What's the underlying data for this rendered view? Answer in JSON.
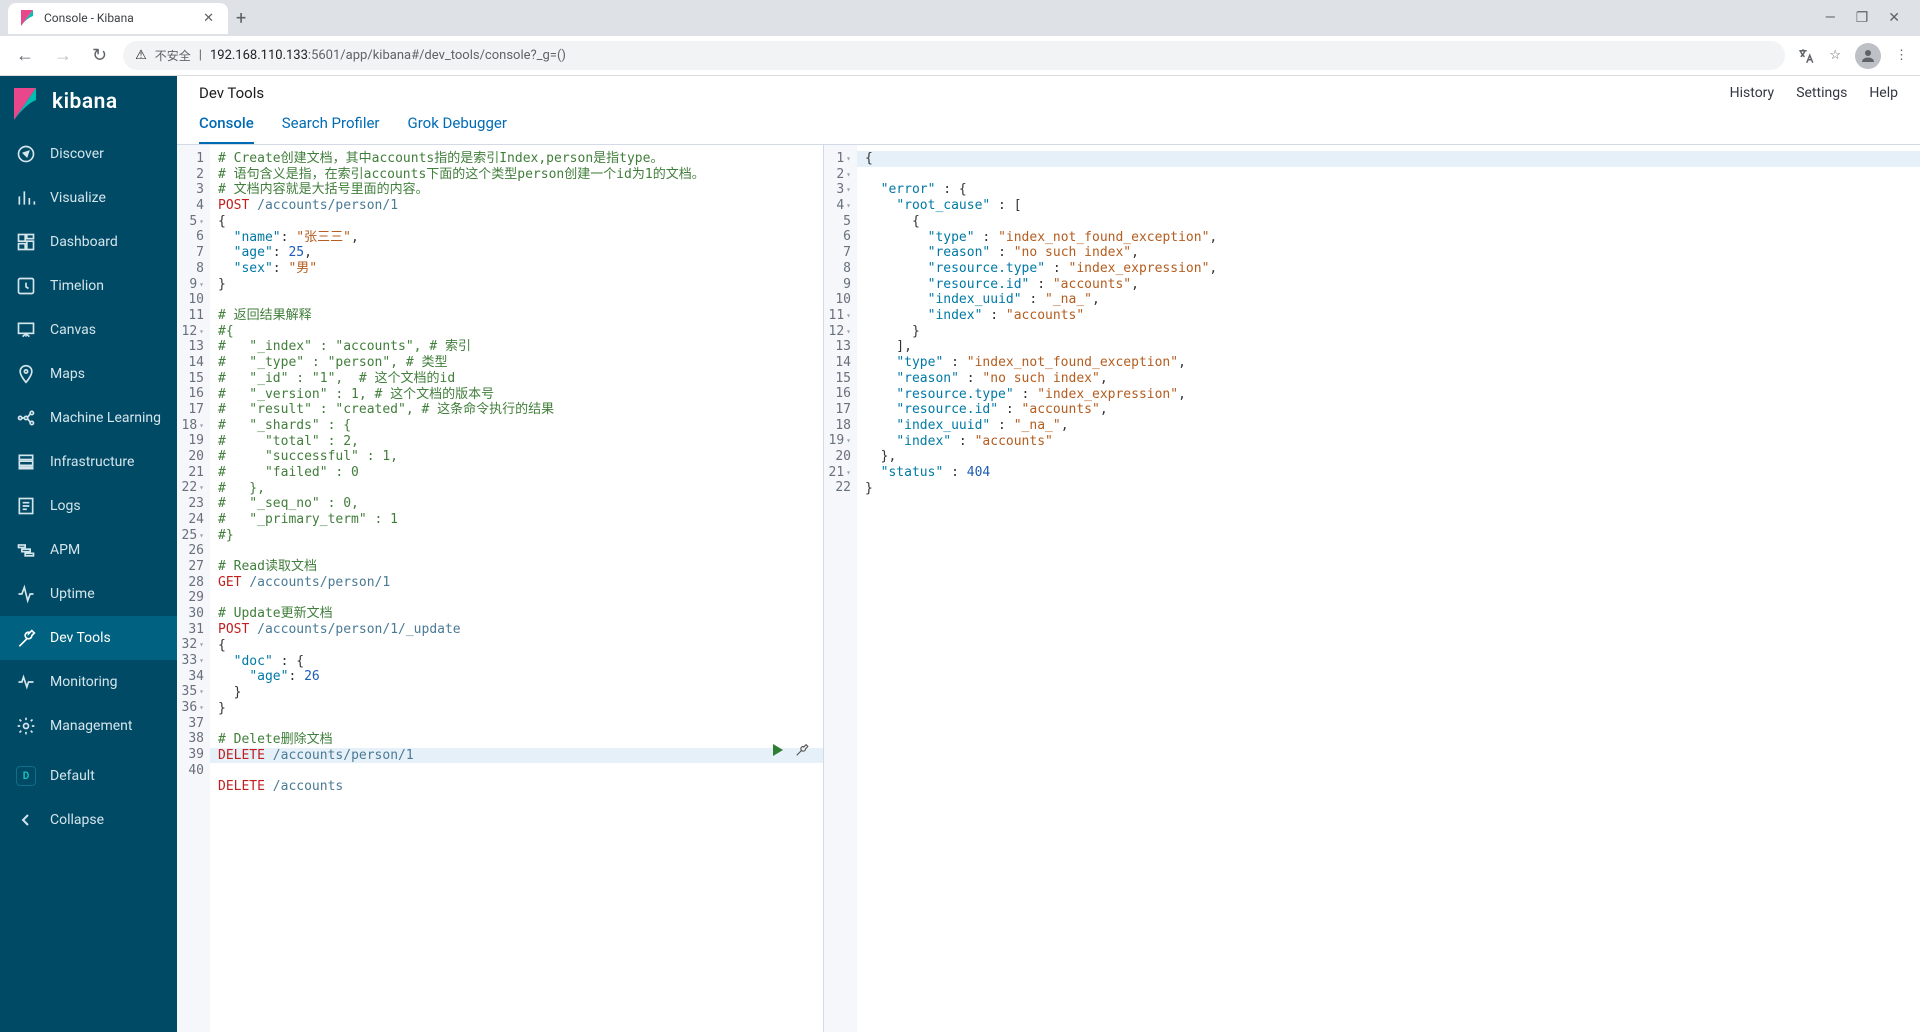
{
  "browser": {
    "tab_title": "Console - Kibana",
    "insecure_label": "不安全",
    "url_host": "192.168.110.133",
    "url_rest": ":5601/app/kibana#/dev_tools/console?_g=()"
  },
  "logo": "kibana",
  "sidebar": [
    {
      "id": "discover",
      "label": "Discover"
    },
    {
      "id": "visualize",
      "label": "Visualize"
    },
    {
      "id": "dashboard",
      "label": "Dashboard"
    },
    {
      "id": "timelion",
      "label": "Timelion"
    },
    {
      "id": "canvas",
      "label": "Canvas"
    },
    {
      "id": "maps",
      "label": "Maps"
    },
    {
      "id": "ml",
      "label": "Machine Learning"
    },
    {
      "id": "infrastructure",
      "label": "Infrastructure"
    },
    {
      "id": "logs",
      "label": "Logs"
    },
    {
      "id": "apm",
      "label": "APM"
    },
    {
      "id": "uptime",
      "label": "Uptime"
    },
    {
      "id": "devtools",
      "label": "Dev Tools",
      "active": true
    },
    {
      "id": "monitoring",
      "label": "Monitoring"
    },
    {
      "id": "management",
      "label": "Management"
    }
  ],
  "space_letter": "D",
  "space_label": "Default",
  "collapse_label": "Collapse",
  "crumb": "Dev Tools",
  "actions": {
    "history": "History",
    "settings": "Settings",
    "help": "Help"
  },
  "tabs": [
    {
      "id": "console",
      "label": "Console",
      "active": true
    },
    {
      "id": "searchprofiler",
      "label": "Search Profiler"
    },
    {
      "id": "grok",
      "label": "Grok Debugger"
    }
  ],
  "request_lines": [
    {
      "n": 1,
      "t": "comment",
      "text": "# Create创建文档，其中accounts指的是索引Index,person是指type。"
    },
    {
      "n": 2,
      "t": "comment",
      "text": "# 语句含义是指，在索引accounts下面的这个类型person创建一个id为1的文档。"
    },
    {
      "n": 3,
      "t": "comment",
      "text": "# 文档内容就是大括号里面的内容。"
    },
    {
      "n": 4,
      "t": "req",
      "method": "POST",
      "path": "/accounts/person/1"
    },
    {
      "n": 5,
      "t": "punct",
      "text": "{",
      "fold": true
    },
    {
      "n": 6,
      "t": "kv",
      "indent": "  ",
      "key": "name",
      "val_str": "张三三",
      "comma": true
    },
    {
      "n": 7,
      "t": "kv",
      "indent": "  ",
      "key": "age",
      "val_num": "25",
      "comma": true
    },
    {
      "n": 8,
      "t": "kv",
      "indent": "  ",
      "key": "sex",
      "val_str": "男"
    },
    {
      "n": 9,
      "t": "punct",
      "text": "}",
      "fold": true
    },
    {
      "n": 10,
      "t": "blank"
    },
    {
      "n": 11,
      "t": "comment",
      "text": "# 返回结果解释"
    },
    {
      "n": 12,
      "t": "comment",
      "text": "#{",
      "fold": true
    },
    {
      "n": 13,
      "t": "comment",
      "text": "#   \"_index\" : \"accounts\", # 索引"
    },
    {
      "n": 14,
      "t": "comment",
      "text": "#   \"_type\" : \"person\", # 类型"
    },
    {
      "n": 15,
      "t": "comment",
      "text": "#   \"_id\" : \"1\",  # 这个文档的id"
    },
    {
      "n": 16,
      "t": "comment",
      "text": "#   \"_version\" : 1, # 这个文档的版本号"
    },
    {
      "n": 17,
      "t": "comment",
      "text": "#   \"result\" : \"created\", # 这条命令执行的结果"
    },
    {
      "n": 18,
      "t": "comment",
      "text": "#   \"_shards\" : {",
      "fold": true
    },
    {
      "n": 19,
      "t": "comment",
      "text": "#     \"total\" : 2,"
    },
    {
      "n": 20,
      "t": "comment",
      "text": "#     \"successful\" : 1,"
    },
    {
      "n": 21,
      "t": "comment",
      "text": "#     \"failed\" : 0"
    },
    {
      "n": 22,
      "t": "comment",
      "text": "#   },",
      "fold": true
    },
    {
      "n": 23,
      "t": "comment",
      "text": "#   \"_seq_no\" : 0,"
    },
    {
      "n": 24,
      "t": "comment",
      "text": "#   \"_primary_term\" : 1"
    },
    {
      "n": 25,
      "t": "comment",
      "text": "#}",
      "fold": true
    },
    {
      "n": 26,
      "t": "blank"
    },
    {
      "n": 27,
      "t": "comment",
      "text": "# Read读取文档"
    },
    {
      "n": 28,
      "t": "req",
      "method": "GET",
      "path": "/accounts/person/1"
    },
    {
      "n": 29,
      "t": "blank"
    },
    {
      "n": 30,
      "t": "comment",
      "text": "# Update更新文档"
    },
    {
      "n": 31,
      "t": "req",
      "method": "POST",
      "path": "/accounts/person/1/_update"
    },
    {
      "n": 32,
      "t": "punct",
      "text": "{",
      "fold": true
    },
    {
      "n": 33,
      "t": "kvopen",
      "indent": "  ",
      "key": "doc",
      "fold": true
    },
    {
      "n": 34,
      "t": "kv",
      "indent": "    ",
      "key": "age",
      "val_num": "26"
    },
    {
      "n": 35,
      "t": "punct",
      "text": "  }",
      "fold": true
    },
    {
      "n": 36,
      "t": "punct",
      "text": "}",
      "fold": true
    },
    {
      "n": 37,
      "t": "blank"
    },
    {
      "n": 38,
      "t": "comment",
      "text": "# Delete删除文档"
    },
    {
      "n": 39,
      "t": "req",
      "method": "DELETE",
      "path": "/accounts/person/1",
      "hl": true
    },
    {
      "n": 40,
      "t": "req",
      "method": "DELETE",
      "path": "/accounts"
    }
  ],
  "response_lines": [
    {
      "n": 1,
      "t": "punct",
      "text": "{",
      "fold": true,
      "hl": true
    },
    {
      "n": 2,
      "t": "kvopen",
      "indent": "  ",
      "key": "error",
      "open": "{",
      "fold": true
    },
    {
      "n": 3,
      "t": "kvopen",
      "indent": "    ",
      "key": "root_cause",
      "open": "[",
      "fold": true
    },
    {
      "n": 4,
      "t": "punct",
      "text": "      {",
      "fold": true
    },
    {
      "n": 5,
      "t": "kv",
      "indent": "        ",
      "key": "type",
      "val_str": "index_not_found_exception",
      "comma": true
    },
    {
      "n": 6,
      "t": "kv",
      "indent": "        ",
      "key": "reason",
      "val_str": "no such index",
      "comma": true
    },
    {
      "n": 7,
      "t": "kv",
      "indent": "        ",
      "key": "resource.type",
      "val_str": "index_expression",
      "comma": true
    },
    {
      "n": 8,
      "t": "kv",
      "indent": "        ",
      "key": "resource.id",
      "val_str": "accounts",
      "comma": true
    },
    {
      "n": 9,
      "t": "kv",
      "indent": "        ",
      "key": "index_uuid",
      "val_str": "_na_",
      "comma": true
    },
    {
      "n": 10,
      "t": "kv",
      "indent": "        ",
      "key": "index",
      "val_str": "accounts"
    },
    {
      "n": 11,
      "t": "punct",
      "text": "      }",
      "fold": true
    },
    {
      "n": 12,
      "t": "punct",
      "text": "    ],",
      "fold": true
    },
    {
      "n": 13,
      "t": "kv",
      "indent": "    ",
      "key": "type",
      "val_str": "index_not_found_exception",
      "comma": true
    },
    {
      "n": 14,
      "t": "kv",
      "indent": "    ",
      "key": "reason",
      "val_str": "no such index",
      "comma": true
    },
    {
      "n": 15,
      "t": "kv",
      "indent": "    ",
      "key": "resource.type",
      "val_str": "index_expression",
      "comma": true
    },
    {
      "n": 16,
      "t": "kv",
      "indent": "    ",
      "key": "resource.id",
      "val_str": "accounts",
      "comma": true
    },
    {
      "n": 17,
      "t": "kv",
      "indent": "    ",
      "key": "index_uuid",
      "val_str": "_na_",
      "comma": true
    },
    {
      "n": 18,
      "t": "kv",
      "indent": "    ",
      "key": "index",
      "val_str": "accounts"
    },
    {
      "n": 19,
      "t": "punct",
      "text": "  },",
      "fold": true
    },
    {
      "n": 20,
      "t": "kv",
      "indent": "  ",
      "key": "status",
      "val_num": "404"
    },
    {
      "n": 21,
      "t": "punct",
      "text": "}",
      "fold": true
    },
    {
      "n": 22,
      "t": "blank"
    }
  ]
}
